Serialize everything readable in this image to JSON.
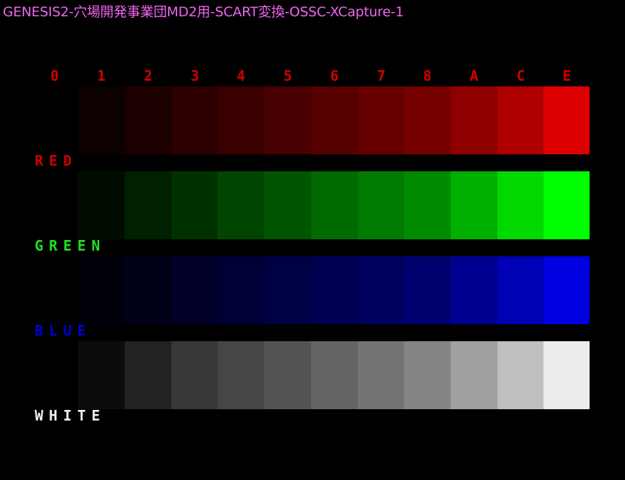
{
  "title": "GENESIS2-穴場開発事業団MD2用-SCART変換-OSSC-XCapture-1",
  "colors": {
    "title": "#ee66ee",
    "level_labels": "#d00000",
    "background": "#000000"
  },
  "level_labels": [
    "0",
    "1",
    "2",
    "3",
    "4",
    "5",
    "6",
    "7",
    "8",
    "A",
    "C",
    "E"
  ],
  "rows": [
    {
      "name": "RED",
      "label_color": "#cc0000",
      "swatches": [
        "#000000",
        "#0c0000",
        "#1c0000",
        "#2c0000",
        "#3a0000",
        "#480000",
        "#560000",
        "#660000",
        "#750000",
        "#8e0000",
        "#ae0000",
        "#dc0000"
      ]
    },
    {
      "name": "GREEN",
      "label_color": "#22dd22",
      "swatches": [
        "#000000",
        "#000c00",
        "#002000",
        "#003200",
        "#004600",
        "#005600",
        "#006a00",
        "#007a00",
        "#008a00",
        "#00b000",
        "#00d800",
        "#00ff00"
      ]
    },
    {
      "name": "BLUE",
      "label_color": "#0000cc",
      "swatches": [
        "#000000",
        "#00000a",
        "#000018",
        "#000028",
        "#000036",
        "#000044",
        "#000050",
        "#000060",
        "#00006e",
        "#000090",
        "#0000b4",
        "#0000e0"
      ]
    },
    {
      "name": "WHITE",
      "label_color": "#f0f0f0",
      "swatches": [
        "#000000",
        "#0c0c0c",
        "#222222",
        "#383838",
        "#464646",
        "#545454",
        "#646464",
        "#747474",
        "#858585",
        "#a0a0a0",
        "#c0c0c0",
        "#ececec"
      ]
    }
  ]
}
